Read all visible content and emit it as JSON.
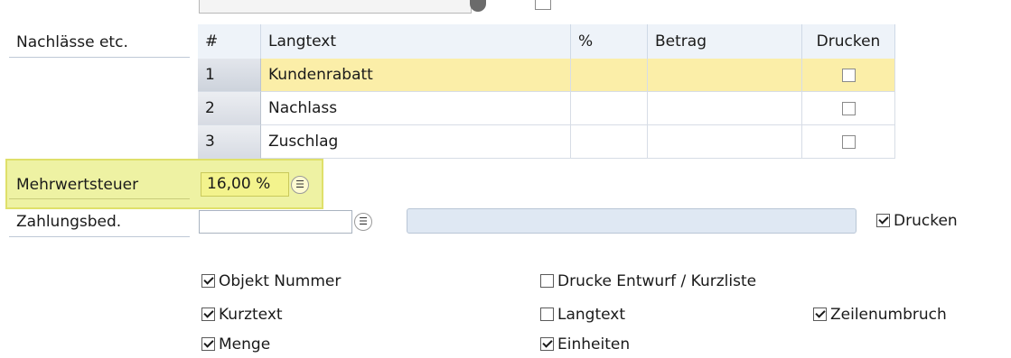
{
  "section_label": "Nachlässe etc.",
  "table": {
    "columns": [
      "#",
      "Langtext",
      "%",
      "Betrag",
      "Drucken"
    ],
    "rows": [
      {
        "num": "1",
        "langtext": "Kundenrabatt",
        "percent": "",
        "betrag": "",
        "drucken": false,
        "selected": true
      },
      {
        "num": "2",
        "langtext": "Nachlass",
        "percent": "",
        "betrag": "",
        "drucken": false,
        "selected": false
      },
      {
        "num": "3",
        "langtext": "Zuschlag",
        "percent": "",
        "betrag": "",
        "drucken": false,
        "selected": false
      }
    ]
  },
  "mwst": {
    "label": "Mehrwertsteuer",
    "value": "16,00 %"
  },
  "zahlung": {
    "label": "Zahlungsbed.",
    "value": "",
    "description": "",
    "print_label": "Drucken",
    "print_checked": true
  },
  "options": {
    "objekt_nummer": {
      "label": "Objekt Nummer",
      "checked": true
    },
    "drucke_entwurf": {
      "label": "Drucke Entwurf / Kurzliste",
      "checked": false
    },
    "kurztext": {
      "label": "Kurztext",
      "checked": true
    },
    "langtext": {
      "label": "Langtext",
      "checked": false
    },
    "zeilenumbruch": {
      "label": "Zeilenumbruch",
      "checked": true
    },
    "menge": {
      "label": "Menge",
      "checked": true
    },
    "einheiten": {
      "label": "Einheiten",
      "checked": true
    }
  },
  "colors": {
    "selected_row": "#fbeea8",
    "highlight": "#eef2a3",
    "field_yellow": "#f3f38d"
  }
}
